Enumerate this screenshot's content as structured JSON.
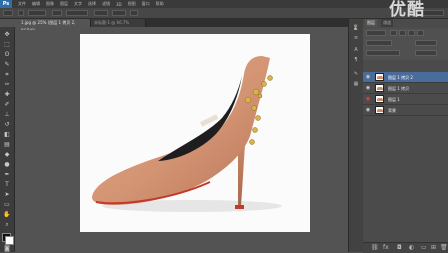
{
  "watermark": "优酷",
  "menubar": {
    "items": [
      "文件",
      "编辑",
      "图像",
      "图层",
      "文字",
      "选择",
      "滤镜",
      "3D",
      "视图",
      "窗口",
      "帮助"
    ]
  },
  "tabs": [
    {
      "label": "1.jpg @ 25% (图层 1 拷贝 2, RGB/8)",
      "active": true
    },
    {
      "label": "未标题-1 @ 66.7%",
      "active": false
    }
  ],
  "panel": {
    "tabs": [
      "图层",
      "通道"
    ],
    "layers": [
      {
        "name": "图层 1 拷贝 2",
        "selected": true,
        "visible": true
      },
      {
        "name": "图层 1 拷贝",
        "selected": false,
        "visible": true
      },
      {
        "name": "图层 1",
        "selected": false,
        "visible": true
      },
      {
        "name": "背景",
        "selected": false,
        "visible": true
      }
    ]
  },
  "colors": {
    "accent": "#4a6c9a",
    "shoe": "#d39474",
    "sole": "#c23a2a"
  }
}
